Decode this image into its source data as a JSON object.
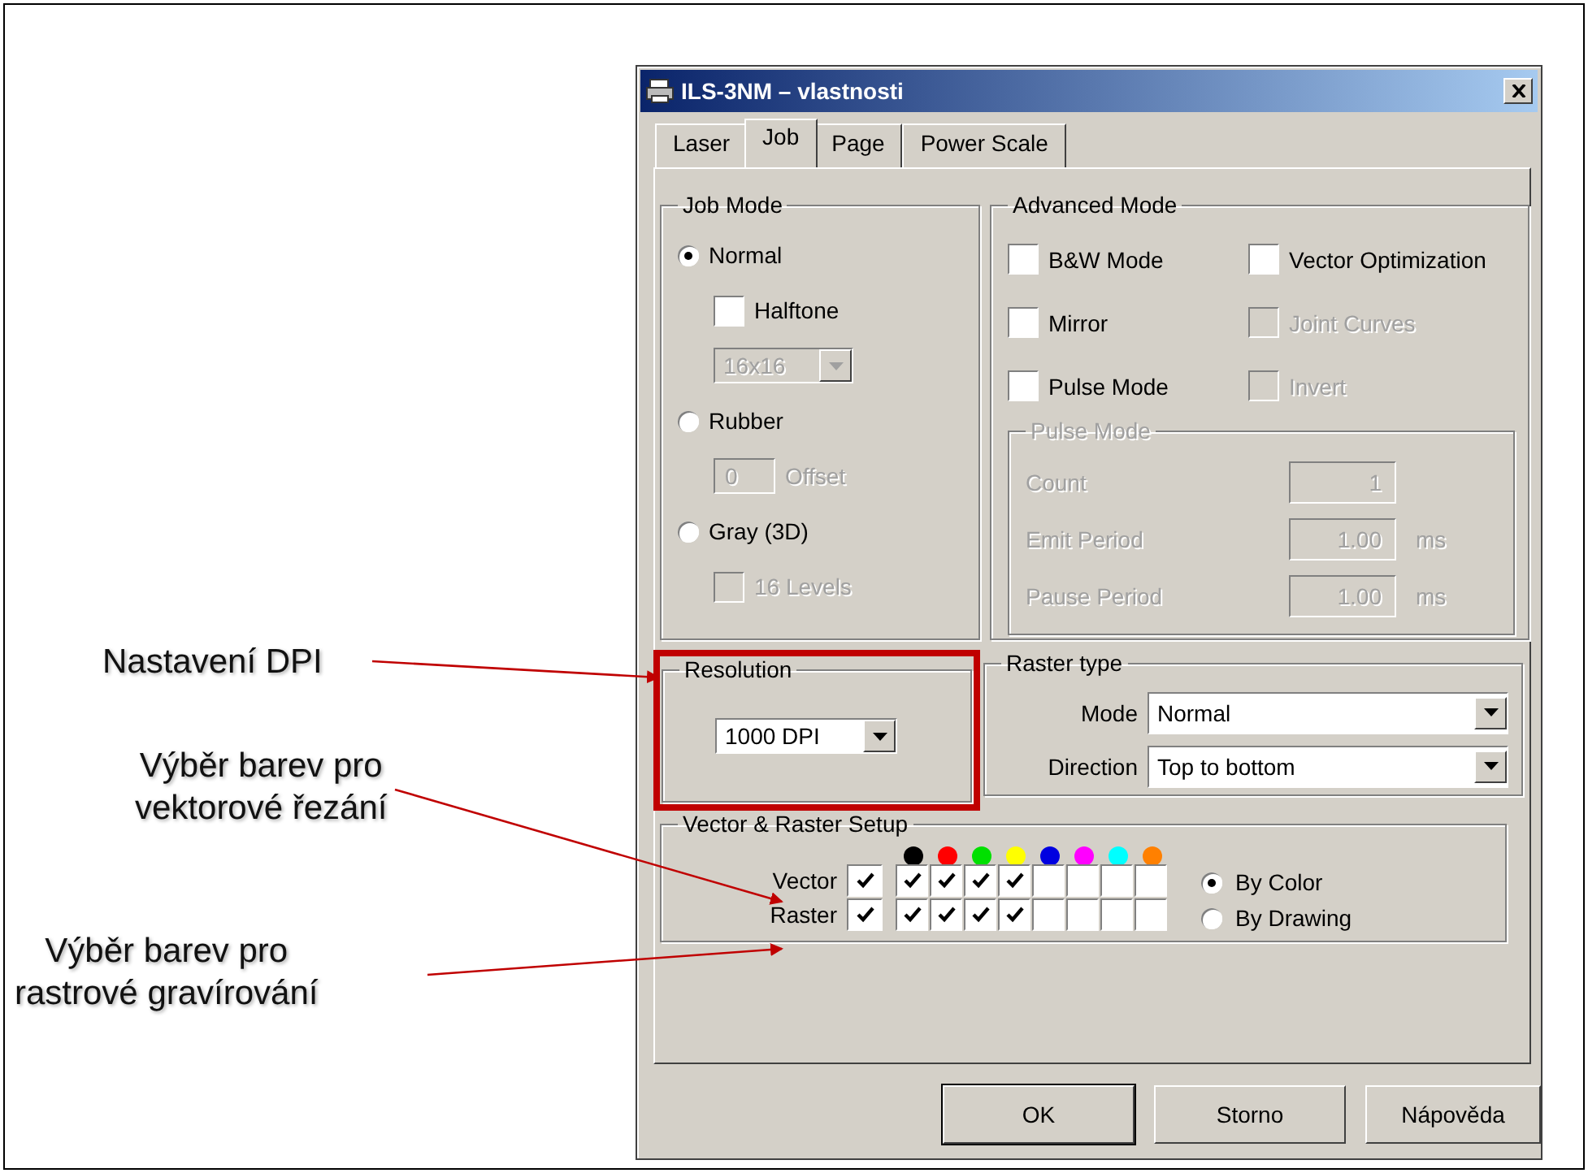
{
  "annotations": [
    {
      "lines": [
        "Nastavení DPI"
      ]
    },
    {
      "lines": [
        "Výběr barev pro",
        "vektorové řezání"
      ]
    },
    {
      "lines": [
        "Výběr barev pro",
        "rastrové gravírování"
      ]
    }
  ],
  "window": {
    "title": "ILS-3NM – vlastnosti"
  },
  "tabs": [
    {
      "label": "Laser",
      "selected": false
    },
    {
      "label": "Job",
      "selected": true
    },
    {
      "label": "Page",
      "selected": false
    },
    {
      "label": "Power Scale",
      "selected": false
    }
  ],
  "job_mode": {
    "title": "Job Mode",
    "items": [
      {
        "kind": "radio",
        "label": "Normal",
        "selected": true
      },
      {
        "kind": "checkbox",
        "label": "Halftone",
        "checked": false,
        "disabled": false
      },
      {
        "kind": "dropdown",
        "value": "16x16",
        "disabled": true
      },
      {
        "kind": "radio",
        "label": "Rubber",
        "selected": false
      },
      {
        "kind": "field",
        "value": "0",
        "label": "Offset",
        "disabled": true
      },
      {
        "kind": "radio",
        "label": "Gray (3D)",
        "selected": false
      },
      {
        "kind": "checkbox",
        "label": "16 Levels",
        "checked": false,
        "disabled": true
      }
    ]
  },
  "advanced_mode": {
    "title": "Advanced Mode",
    "options": [
      {
        "label": "B&W Mode",
        "checked": false,
        "disabled": false
      },
      {
        "label": "Vector Optimization",
        "checked": false,
        "disabled": false
      },
      {
        "label": "Mirror",
        "checked": false,
        "disabled": false
      },
      {
        "label": "Joint Curves",
        "checked": false,
        "disabled": true
      },
      {
        "label": "Pulse Mode",
        "checked": false,
        "disabled": false
      },
      {
        "label": "Invert",
        "checked": false,
        "disabled": true
      }
    ],
    "pulse_mode": {
      "title": "Pulse Mode",
      "disabled": true,
      "rows": [
        {
          "label": "Count",
          "value": "1"
        },
        {
          "label": "Emit Period",
          "value": "1.00",
          "unit": "ms"
        },
        {
          "label": "Pause Period",
          "value": "1.00",
          "unit": "ms"
        }
      ]
    }
  },
  "resolution": {
    "title": "Resolution",
    "value": "1000 DPI",
    "highlighted": true
  },
  "raster_type": {
    "title": "Raster type",
    "fields": [
      {
        "label": "Mode",
        "value": "Normal"
      },
      {
        "label": "Direction",
        "value": "Top to bottom"
      }
    ]
  },
  "vector_raster_setup": {
    "title": "Vector & Raster Setup",
    "swatches": [
      {
        "color": "#000000"
      },
      {
        "color": "#ff0000"
      },
      {
        "color": "#00e000"
      },
      {
        "color": "#ffff00"
      },
      {
        "color": "#0000e0"
      },
      {
        "color": "#ff00ff"
      },
      {
        "color": "#00ffff"
      },
      {
        "color": "#ff8000"
      }
    ],
    "rows": [
      {
        "label": "Vector",
        "all": true,
        "colors": [
          {
            "checked": true
          },
          {
            "checked": true
          },
          {
            "checked": true
          },
          {
            "checked": true
          },
          {
            "checked": false
          },
          {
            "checked": false
          },
          {
            "checked": false
          },
          {
            "checked": false
          }
        ]
      },
      {
        "label": "Raster",
        "all": true,
        "colors": [
          {
            "checked": true
          },
          {
            "checked": true
          },
          {
            "checked": true
          },
          {
            "checked": true
          },
          {
            "checked": false
          },
          {
            "checked": false
          },
          {
            "checked": false
          },
          {
            "checked": false
          }
        ]
      }
    ],
    "modes": [
      {
        "label": "By Color",
        "selected": true
      },
      {
        "label": "By Drawing",
        "selected": false
      }
    ]
  },
  "buttons": [
    {
      "label": "OK",
      "default": true
    },
    {
      "label": "Storno",
      "default": false
    },
    {
      "label": "Nápověda",
      "default": false
    }
  ]
}
